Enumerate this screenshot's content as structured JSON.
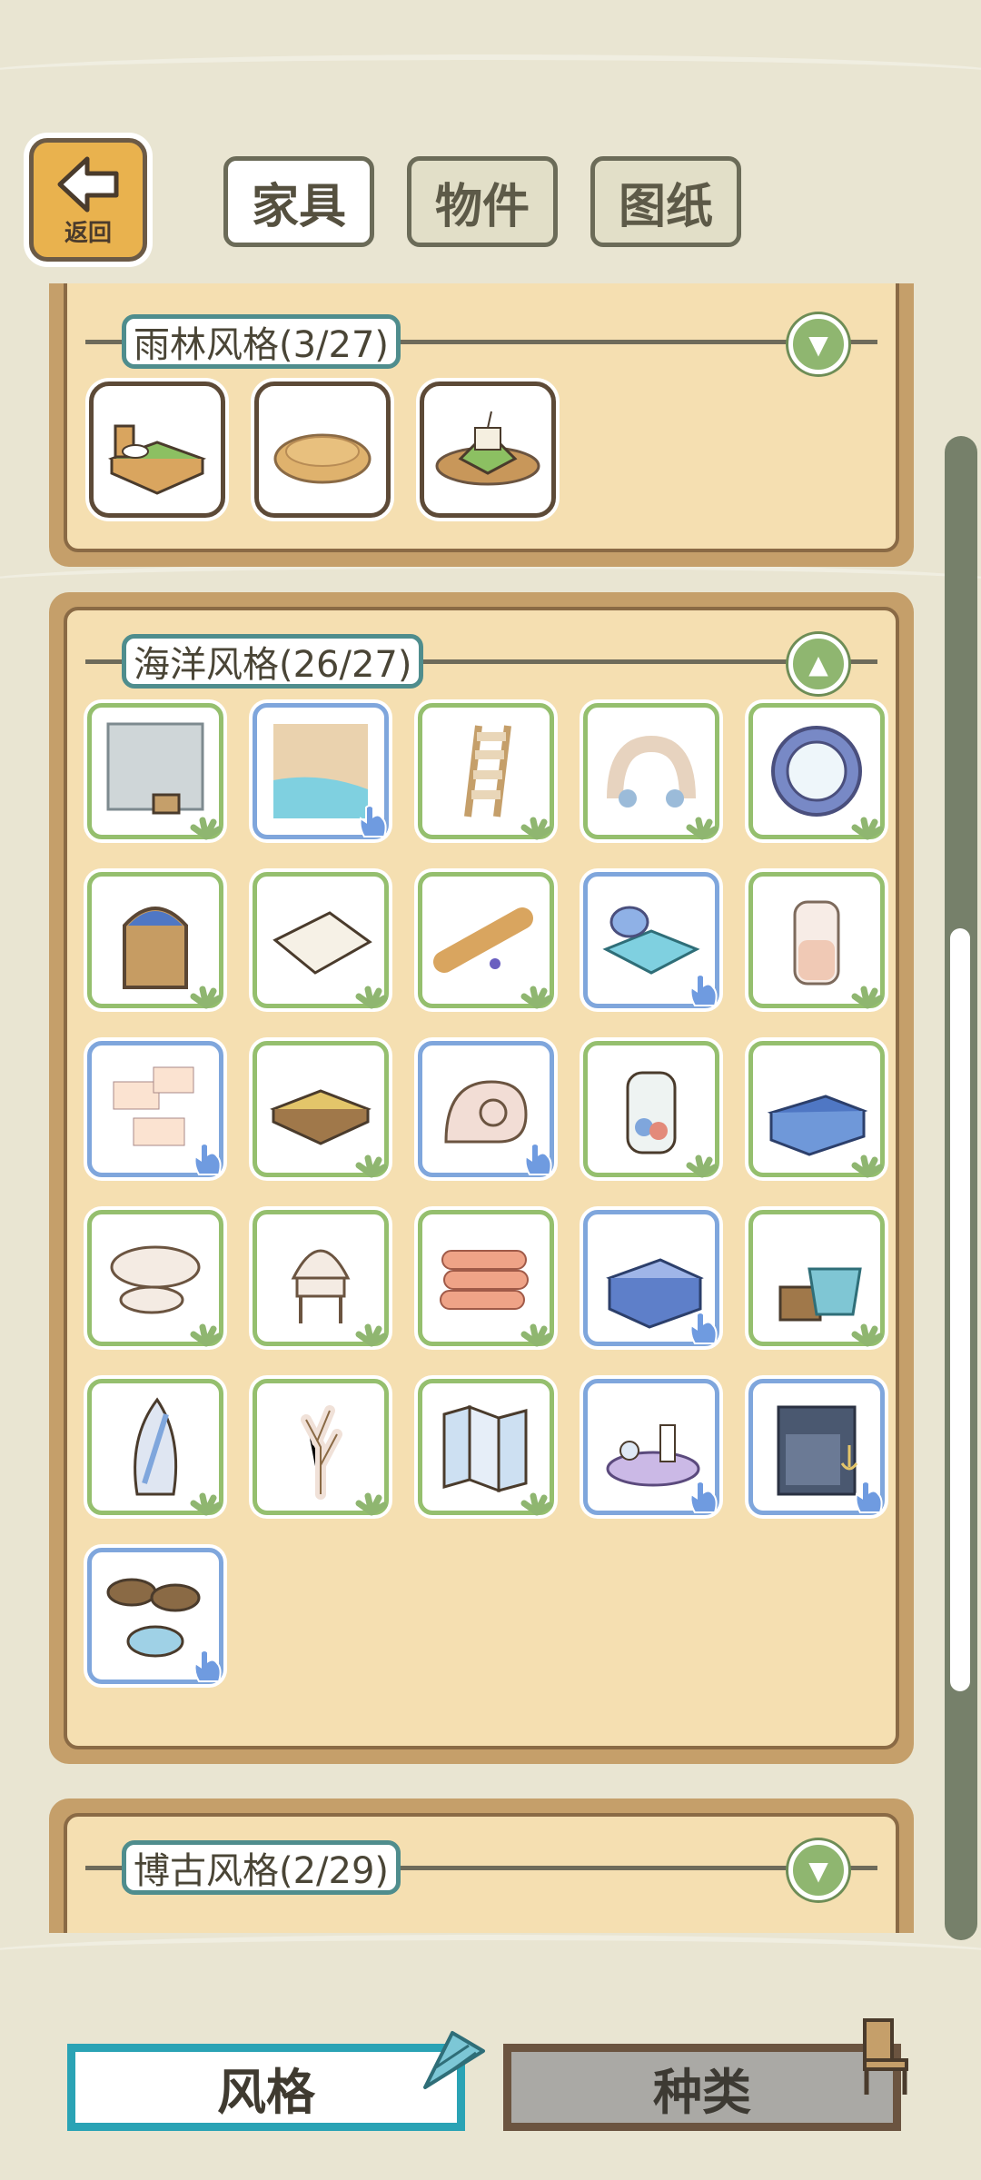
{
  "header": {
    "back_label": "返回",
    "tabs": [
      {
        "label": "家具",
        "active": true
      },
      {
        "label": "物件",
        "active": false
      },
      {
        "label": "图纸",
        "active": false
      }
    ]
  },
  "sections": [
    {
      "title": "雨林风格(3/27)",
      "expanded": false,
      "items": [
        {
          "icon": "bed-icon"
        },
        {
          "icon": "round-mat-icon"
        },
        {
          "icon": "leaf-cake-icon"
        }
      ]
    },
    {
      "title": "海洋风格(26/27)",
      "expanded": true,
      "items": [
        {
          "icon": "wallpaper-bucket-icon",
          "badge": "frog-paw"
        },
        {
          "icon": "sea-floor-icon",
          "badge": "hand"
        },
        {
          "icon": "ladder-icon",
          "badge": "frog-paw"
        },
        {
          "icon": "shell-arch-icon",
          "badge": "frog-paw"
        },
        {
          "icon": "porthole-mirror-icon",
          "badge": "frog-paw"
        },
        {
          "icon": "arched-door-icon",
          "badge": "frog-paw"
        },
        {
          "icon": "rug-icon",
          "badge": "frog-paw"
        },
        {
          "icon": "scroll-icon",
          "badge": "frog-paw"
        },
        {
          "icon": "shell-bed-icon",
          "badge": "hand"
        },
        {
          "icon": "sand-jar-icon",
          "badge": "frog-paw"
        },
        {
          "icon": "notes-board-icon",
          "badge": "hand"
        },
        {
          "icon": "low-table-icon",
          "badge": "frog-paw"
        },
        {
          "icon": "ammonite-icon",
          "badge": "hand"
        },
        {
          "icon": "shell-jar-icon",
          "badge": "frog-paw"
        },
        {
          "icon": "chest-icon",
          "badge": "frog-paw"
        },
        {
          "icon": "coral-table-icon",
          "badge": "frog-paw"
        },
        {
          "icon": "shell-chair-icon",
          "badge": "frog-paw"
        },
        {
          "icon": "towels-icon",
          "badge": "frog-paw"
        },
        {
          "icon": "sideboard-icon",
          "badge": "hand"
        },
        {
          "icon": "wash-basin-icon",
          "badge": "frog-paw"
        },
        {
          "icon": "surfboard-mirror-icon",
          "badge": "frog-paw"
        },
        {
          "icon": "coral-branch-icon",
          "badge": "frog-paw"
        },
        {
          "icon": "folding-screen-icon",
          "badge": "frog-paw"
        },
        {
          "icon": "shell-candle-icon",
          "badge": "hand"
        },
        {
          "icon": "anchor-cabinet-icon",
          "badge": "hand"
        },
        {
          "icon": "barrels-icon",
          "badge": "hand"
        }
      ]
    },
    {
      "title": "博古风格(2/29)",
      "expanded": false,
      "items": []
    }
  ],
  "footer": {
    "style_label": "风格",
    "kind_label": "种类"
  },
  "colors": {
    "background": "#e9e5d2",
    "panel_fill": "#f5dfb1",
    "panel_frame": "#c59f6a",
    "border_green": "#95bf6e",
    "border_blue": "#7fa6dc",
    "title_border": "#4f8d8d",
    "style_button_border": "#2aa3b5"
  }
}
